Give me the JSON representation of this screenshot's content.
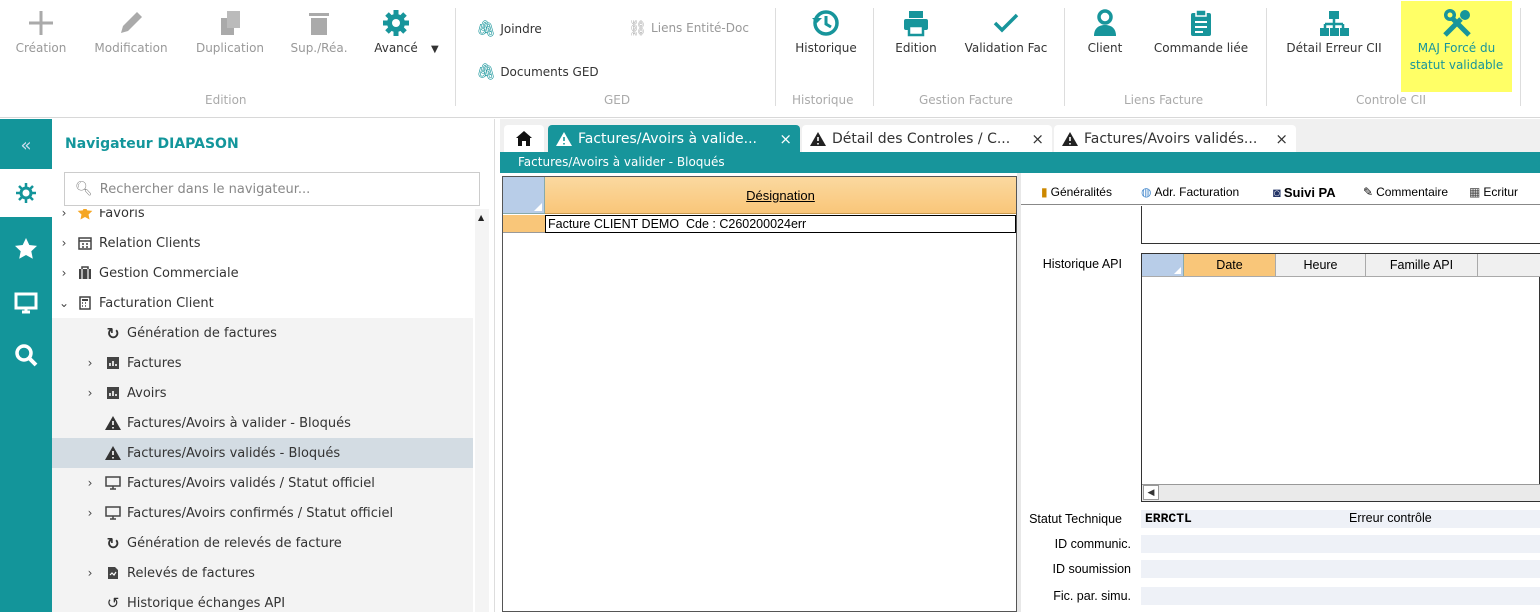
{
  "ribbon": {
    "edition": {
      "create": "Création",
      "modify": "Modification",
      "duplicate": "Duplication",
      "delete": "Sup./Réa.",
      "advanced": "Avancé",
      "group": "Edition"
    },
    "ged": {
      "attach": "Joindre",
      "entity_links": "Liens Entité-Doc",
      "ged_docs": "Documents GED",
      "group": "GED"
    },
    "history": {
      "label": "Historique",
      "group": "Historique"
    },
    "invoice": {
      "edition": "Edition",
      "validation": "Validation Fac",
      "group": "Gestion Facture"
    },
    "links": {
      "client": "Client",
      "linked_order": "Commande liée",
      "group": "Liens Facture"
    },
    "control": {
      "error_detail": "Détail Erreur CII",
      "force_update_line1": "MAJ Forcé du",
      "force_update_line2": "statut validable",
      "group": "Controle CII"
    },
    "colors": {
      "highlight": "#ffff66",
      "accent": "#13959a",
      "icon": "#17959b"
    }
  },
  "sidebar_icons": [
    "collapse-icon",
    "network-icon",
    "star-icon",
    "monitor-icon",
    "search-icon"
  ],
  "navigator": {
    "title": "Navigateur DIAPASON",
    "search_placeholder": "Rechercher dans le navigateur...",
    "items": [
      {
        "label": "Favoris",
        "icon": "star-icon"
      },
      {
        "label": "Relation Clients",
        "icon": "calendar-icon"
      },
      {
        "label": "Gestion Commerciale",
        "icon": "briefcase-icon"
      },
      {
        "label": "Facturation Client",
        "icon": "calculator-icon"
      },
      {
        "label": "Génération de factures",
        "icon": "refresh-icon"
      },
      {
        "label": "Factures",
        "icon": "report-icon"
      },
      {
        "label": "Avoirs",
        "icon": "report-icon"
      },
      {
        "label": "Factures/Avoirs à valider - Bloqués",
        "icon": "warning-icon"
      },
      {
        "label": "Factures/Avoirs validés - Bloqués",
        "icon": "warning-icon"
      },
      {
        "label": "Factures/Avoirs validés / Statut officiel",
        "icon": "monitor-icon"
      },
      {
        "label": "Factures/Avoirs confirmés / Statut officiel",
        "icon": "monitor-icon"
      },
      {
        "label": "Génération de relevés de facture",
        "icon": "refresh-icon"
      },
      {
        "label": "Relevés de factures",
        "icon": "document-icon"
      },
      {
        "label": "Historique échanges API",
        "icon": "history-icon"
      }
    ]
  },
  "tabs": [
    {
      "label": "Factures/Avoirs à valide...",
      "close": "×"
    },
    {
      "label": "Détail des Controles / C...",
      "close": "×"
    },
    {
      "label": "Factures/Avoirs validés...",
      "close": "×"
    }
  ],
  "subtitle": "Factures/Avoirs à valider - Bloqués",
  "grid": {
    "column": "Désignation",
    "rows": [
      "Facture CLIENT DEMO  Cde : C260200024err"
    ]
  },
  "detail": {
    "tabs": [
      "Généralités",
      "Adr. Facturation",
      "Suivi PA",
      "Commentaire",
      "Ecritur"
    ],
    "history_label": "Historique API",
    "history_columns": [
      "Date",
      "Heure",
      "Famille API"
    ],
    "status_label": "Statut Technique",
    "status_code": "ERRCTL",
    "status_text": "Erreur contrôle",
    "id_comm_label": "ID communic.",
    "id_submission_label": "ID soumission",
    "sim_label": "Fic. par. simu."
  }
}
